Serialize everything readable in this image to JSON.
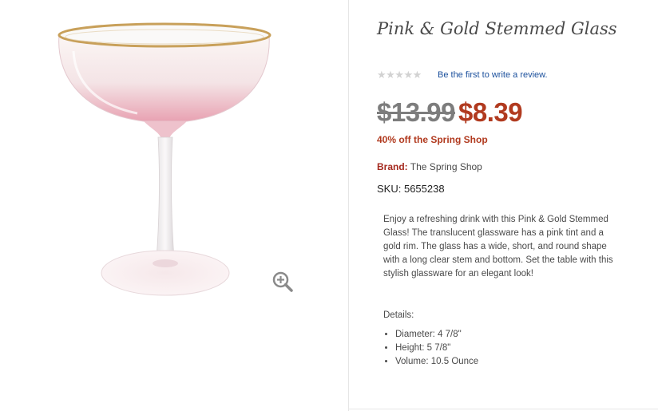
{
  "product": {
    "title": "Pink & Gold Stemmed Glass",
    "rating": {
      "stars": "★★★★★",
      "review_link": "Be the first to write a review."
    },
    "price": {
      "old": "$13.99",
      "new": "$8.39"
    },
    "promo": "40% off the Spring Shop",
    "brand": {
      "label": "Brand:",
      "value": "The Spring Shop"
    },
    "sku": {
      "label": "SKU:",
      "value": "5655238"
    },
    "description": "Enjoy a refreshing drink with this Pink & Gold Stemmed Glass! The translucent glassware has a pink tint and a gold rim. The glass has a wide, short, and round shape with a long clear stem and bottom. Set the table with this stylish glassware for an elegant look!",
    "details_label": "Details:",
    "details": [
      "Diameter: 4 7/8\"",
      "Height: 5 7/8\"",
      "Volume: 10.5 Ounce"
    ]
  },
  "icons": {
    "zoom": "zoom-in-icon",
    "star": "star-icon"
  },
  "colors": {
    "sale_red": "#b13a1f",
    "link_blue": "#1a4f9c",
    "gold_rim": "#c8a05a",
    "pink_tint": "#e6a5b5"
  }
}
